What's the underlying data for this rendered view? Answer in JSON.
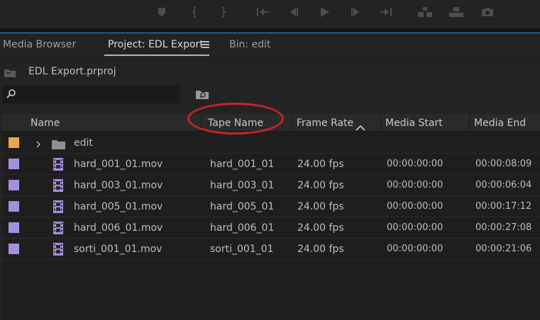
{
  "transport": {
    "buttons": [
      {
        "name": "add-marker-icon"
      },
      {
        "name": "mark-in-icon"
      },
      {
        "name": "mark-out-icon"
      },
      {
        "name": "go-to-in-icon"
      },
      {
        "name": "step-back-icon"
      },
      {
        "name": "play-icon"
      },
      {
        "name": "step-forward-icon"
      },
      {
        "name": "go-to-out-icon"
      },
      {
        "name": "insert-icon"
      },
      {
        "name": "overwrite-icon"
      },
      {
        "name": "export-frame-icon"
      }
    ]
  },
  "tabs": {
    "media_browser": "Media Browser",
    "project": "Project: EDL Export",
    "bin": "Bin: edit"
  },
  "project": {
    "file_name": "EDL Export.prproj"
  },
  "search": {
    "value": "",
    "placeholder": ""
  },
  "columns": {
    "name": "Name",
    "tape_name": "Tape Name",
    "frame_rate": "Frame Rate",
    "media_start": "Media Start",
    "media_end": "Media End"
  },
  "rows": [
    {
      "type": "bin",
      "label_color": "#e9a84a",
      "name": "edit",
      "tape_name": "",
      "frame_rate": "",
      "media_start": "",
      "media_end": ""
    },
    {
      "type": "clip",
      "label_color": "#a58fdc",
      "name": "hard_001_01.mov",
      "tape_name": "hard_001_01",
      "frame_rate": "24.00 fps",
      "media_start": "00:00:00:00",
      "media_end": "00:00:08:09"
    },
    {
      "type": "clip",
      "label_color": "#a58fdc",
      "name": "hard_003_01.mov",
      "tape_name": "hard_003_01",
      "frame_rate": "24.00 fps",
      "media_start": "00:00:00:00",
      "media_end": "00:00:06:04"
    },
    {
      "type": "clip",
      "label_color": "#a58fdc",
      "name": "hard_005_01.mov",
      "tape_name": "hard_005_01",
      "frame_rate": "24.00 fps",
      "media_start": "00:00:00:00",
      "media_end": "00:00:17:12"
    },
    {
      "type": "clip",
      "label_color": "#a58fdc",
      "name": "hard_006_01.mov",
      "tape_name": "hard_006_01",
      "frame_rate": "24.00 fps",
      "media_start": "00:00:00:00",
      "media_end": "00:00:27:08"
    },
    {
      "type": "clip",
      "label_color": "#a58fdc",
      "name": "sorti_001_01.mov",
      "tape_name": "sorti_001_01",
      "frame_rate": "24.00 fps",
      "media_start": "00:00:00:00",
      "media_end": "00:00:21:06"
    }
  ],
  "colors": {
    "accent": "#2d8ceb",
    "annotation": "#c52626"
  }
}
